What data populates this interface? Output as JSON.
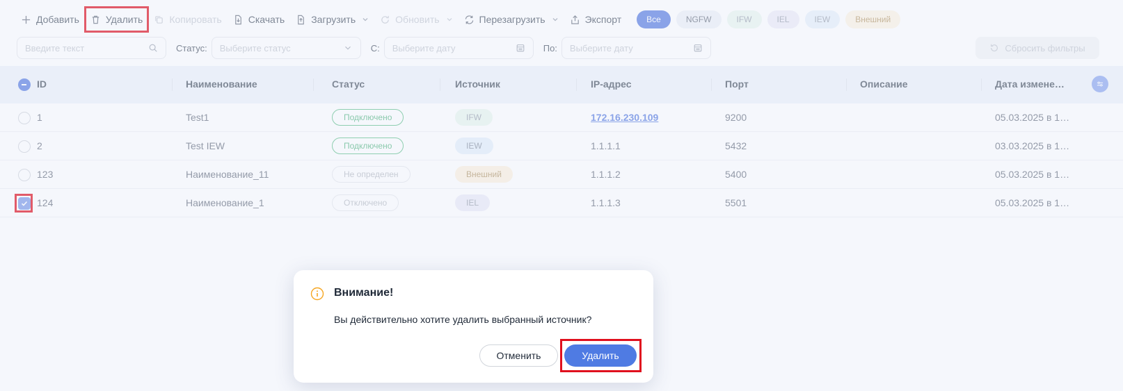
{
  "toolbar": {
    "add": "Добавить",
    "delete": "Удалить",
    "copy": "Копировать",
    "download": "Скачать",
    "upload": "Загрузить",
    "refresh": "Обновить",
    "reload": "Перезагрузить",
    "export": "Экспорт"
  },
  "chips": [
    "Все",
    "NGFW",
    "IFW",
    "IEL",
    "IEW",
    "Внешний"
  ],
  "filters": {
    "search_placeholder": "Введите текст",
    "status_label": "Статус:",
    "status_placeholder": "Выберите статус",
    "from_label": "С:",
    "from_placeholder": "Выберите дату",
    "to_label": "По:",
    "to_placeholder": "Выберите дату",
    "reset": "Сбросить фильтры"
  },
  "table": {
    "columns": [
      "ID",
      "Наименование",
      "Статус",
      "Источник",
      "IP-адрес",
      "Порт",
      "Описание",
      "Дата измене…"
    ],
    "rows": [
      {
        "id": "1",
        "name": "Test1",
        "status": "Подключено",
        "source": "IFW",
        "ip": "172.16.230.109",
        "port": "9200",
        "desc": "",
        "date": "05.03.2025 в 1…"
      },
      {
        "id": "2",
        "name": "Test IEW",
        "status": "Подключено",
        "source": "IEW",
        "ip": "1.1.1.1",
        "port": "5432",
        "desc": "",
        "date": "03.03.2025 в 1…"
      },
      {
        "id": "123",
        "name": "Наименование_11",
        "status": "Не определен",
        "source": "Внешний",
        "ip": "1.1.1.2",
        "port": "5400",
        "desc": "",
        "date": "05.03.2025 в 1…"
      },
      {
        "id": "124",
        "name": "Наименование_1",
        "status": "Отключено",
        "source": "IEL",
        "ip": "1.1.1.3",
        "port": "5501",
        "desc": "",
        "date": "05.03.2025 в 1…"
      }
    ]
  },
  "dialog": {
    "title": "Внимание!",
    "message": "Вы действительно хотите удалить выбранный источник?",
    "cancel": "Отменить",
    "confirm": "Удалить"
  },
  "colors": {
    "accent": "#4f7be3",
    "highlight": "#e0101e",
    "warning_icon": "#f5a623",
    "connected": "#5ab884"
  }
}
